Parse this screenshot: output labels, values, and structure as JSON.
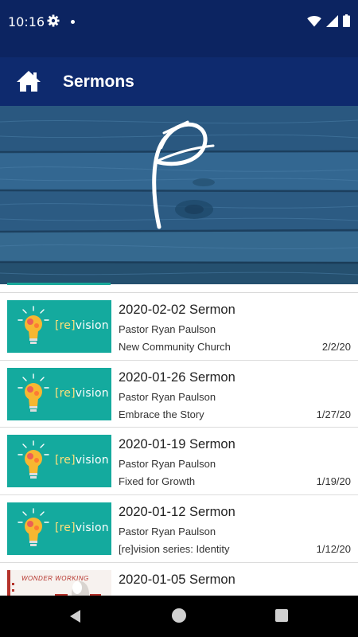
{
  "status_bar": {
    "time": "10:16"
  },
  "header": {
    "title": "Sermons"
  },
  "thumb_label": {
    "prefix": "[re]",
    "suffix": "vision"
  },
  "sermons": [
    {
      "title": "2020-02-02 Sermon",
      "speaker": "Pastor Ryan Paulson",
      "series": "New Community Church",
      "date": "2/2/20"
    },
    {
      "title": "2020-01-26 Sermon",
      "speaker": "Pastor Ryan Paulson",
      "series": "Embrace the Story",
      "date": "1/27/20"
    },
    {
      "title": "2020-01-19 Sermon",
      "speaker": "Pastor Ryan Paulson",
      "series": "Fixed for Growth",
      "date": "1/19/20"
    },
    {
      "title": "2020-01-12 Sermon",
      "speaker": "Pastor Ryan Paulson",
      "series": "[re]vision series: Identity",
      "date": "1/12/20"
    },
    {
      "title": "2020-01-05 Sermon",
      "thumb_text": "WONDER WORKING"
    }
  ],
  "colors": {
    "status_bar": "#0c2461",
    "app_bar": "#0e2a6e",
    "thumb_teal": "#14aa9e",
    "wood_blue": "#2e5f86"
  },
  "icons": {
    "home": "home-icon",
    "gear": "gear-icon",
    "wifi": "wifi-icon",
    "signal": "signal-icon",
    "battery": "battery-icon",
    "bulb": "lightbulb-icon",
    "logo": "church-logo"
  }
}
